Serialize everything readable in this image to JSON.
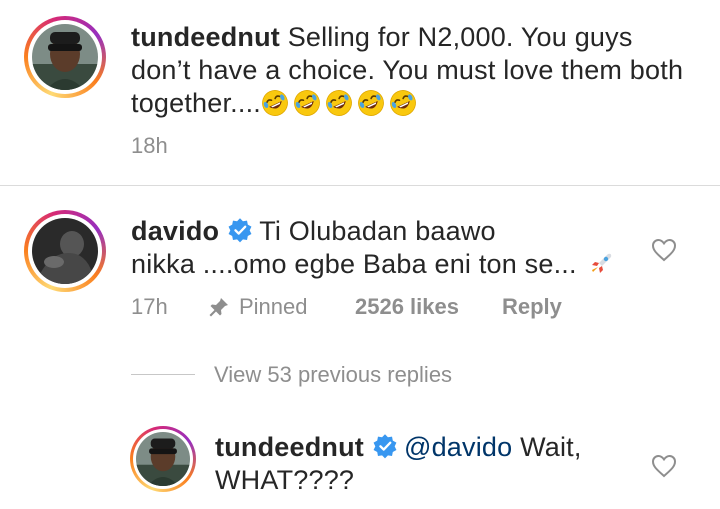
{
  "caption": {
    "username": "tundeednut",
    "text": "Selling for N2,000. You guys don’t have a choice. You must love them both together....",
    "emoji_count": 5,
    "time": "18h"
  },
  "comment": {
    "username": "davido",
    "verified": true,
    "text_line1": "Ti Olubadan baawo",
    "text_line2": "nikka ....omo egbe Baba eni ton se...",
    "emoji": "rocket-icon",
    "time": "17h",
    "pinned_label": "Pinned",
    "likes_label": "2526 likes",
    "reply_label": "Reply"
  },
  "view_replies": "View 53 previous replies",
  "reply": {
    "username": "tundeednut",
    "verified": true,
    "mention": "@davido",
    "text": "Wait,",
    "text_line2": "WHAT????"
  },
  "colors": {
    "text": "#262626",
    "muted": "#8e8e8e",
    "verified": "#3897f0",
    "mention": "#003569",
    "divider": "#dbdbdb"
  }
}
